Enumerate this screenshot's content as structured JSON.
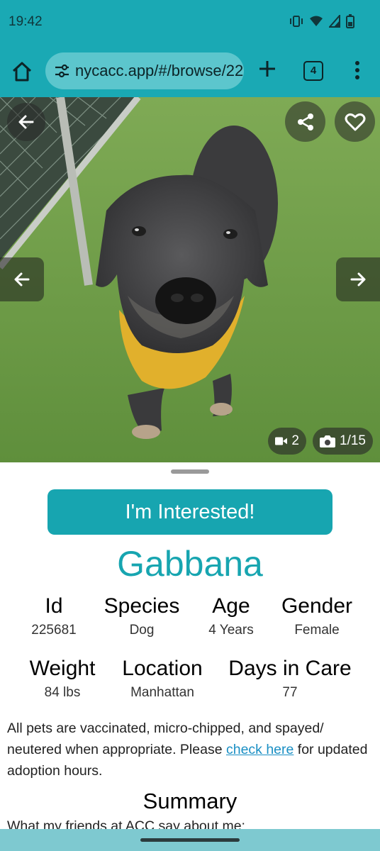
{
  "status_bar": {
    "time": "19:42"
  },
  "browser": {
    "url": "nycacc.app/#/browse/22",
    "tab_count": "4"
  },
  "photo": {
    "video_count": "2",
    "photo_counter": "1/15"
  },
  "actions": {
    "interested_label": "I'm Interested!"
  },
  "pet": {
    "name": "Gabbana",
    "stats_row1": [
      {
        "label": "Id",
        "value": "225681"
      },
      {
        "label": "Species",
        "value": "Dog"
      },
      {
        "label": "Age",
        "value": "4 Years"
      },
      {
        "label": "Gender",
        "value": "Female"
      }
    ],
    "stats_row2": [
      {
        "label": "Weight",
        "value": "84 lbs"
      },
      {
        "label": "Location",
        "value": "Manhattan"
      },
      {
        "label": "Days in Care",
        "value": "77"
      }
    ]
  },
  "notice": {
    "before": "All pets are vaccinated, micro-chipped, and spayed/ neutered when appropriate. Please ",
    "link": "check here",
    "after": " for updated adoption hours."
  },
  "summary": {
    "title": "Summary",
    "intro": "What my friends at ACC say about me:"
  },
  "colors": {
    "accent": "#17a5b0",
    "status_bar": "#1aa9b4",
    "link": "#1a8fc4"
  }
}
